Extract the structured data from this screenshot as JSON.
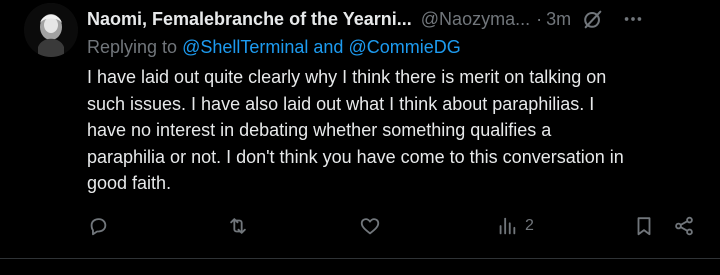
{
  "tweet": {
    "display_name": "Naomi, Femalebranche of the Yearni...",
    "handle": "@Naozyma...",
    "separator": "·",
    "time": "3m",
    "replying_prefix": "Replying to ",
    "mention_1": "@ShellTerminal",
    "mention_and": " and ",
    "mention_2": "@CommieDG",
    "text": "I have laid out quite clearly why I think there is merit on talking on\nsuch issues. I have also laid out what I think about paraphilias. I\nhave no interest in debating whether something qualifies a\nparaphilia or not. I don't think you have come to this conversation in\ngood faith.",
    "views_count": "2"
  },
  "icons": {
    "grok": "grok-icon",
    "more": "more-icon",
    "reply": "reply-icon",
    "retweet": "retweet-icon",
    "like": "like-icon",
    "views": "views-icon",
    "bookmark": "bookmark-icon",
    "share": "share-icon"
  },
  "colors": {
    "background": "#000000",
    "text": "#e7e9ea",
    "muted": "#71767b",
    "link": "#1d9bf0"
  }
}
